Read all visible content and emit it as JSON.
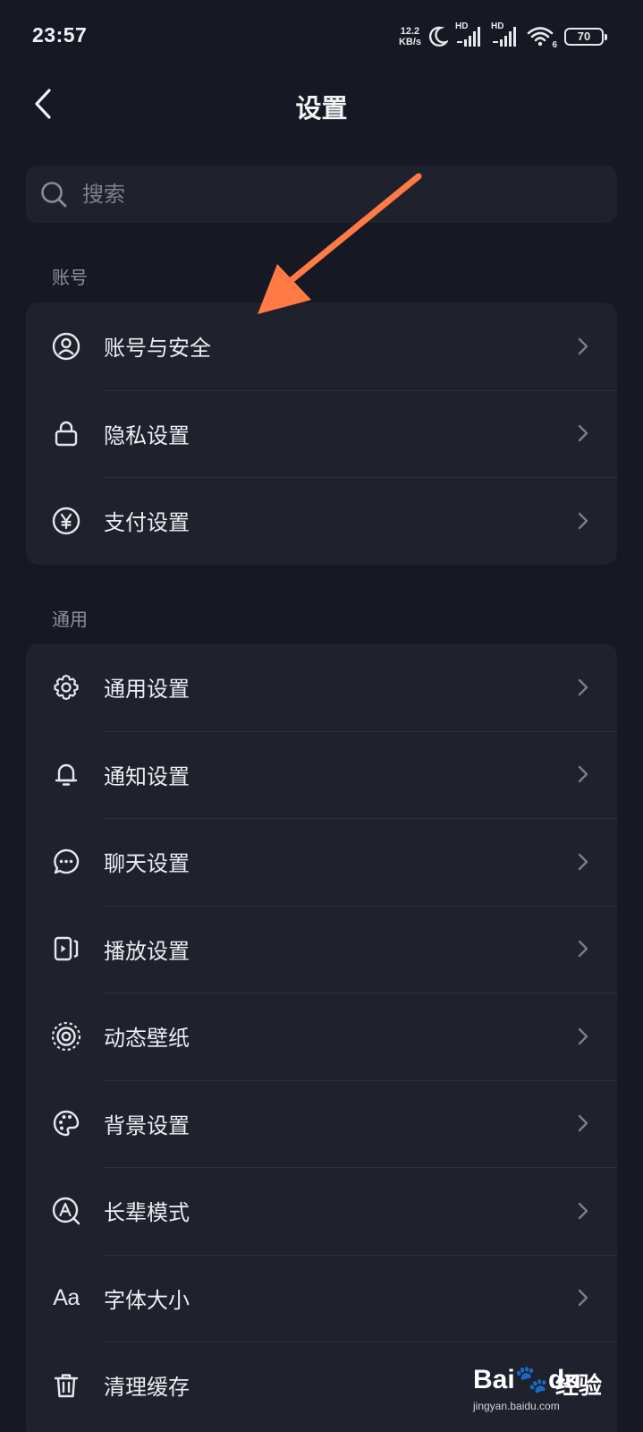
{
  "status_bar": {
    "time": "23:57",
    "net_speed_value": "12.2",
    "net_speed_unit": "KB/s",
    "signal_1_label": "HD",
    "signal_2_label": "HD",
    "wifi_badge": "6",
    "battery": "70"
  },
  "header": {
    "title": "设置"
  },
  "search": {
    "placeholder": "搜索"
  },
  "sections": [
    {
      "label": "账号",
      "items": [
        {
          "label": "账号与安全",
          "icon": "user-circle-icon"
        },
        {
          "label": "隐私设置",
          "icon": "lock-icon"
        },
        {
          "label": "支付设置",
          "icon": "yuan-icon"
        }
      ]
    },
    {
      "label": "通用",
      "items": [
        {
          "label": "通用设置",
          "icon": "gear-icon"
        },
        {
          "label": "通知设置",
          "icon": "bell-icon"
        },
        {
          "label": "聊天设置",
          "icon": "chat-bubble-icon"
        },
        {
          "label": "播放设置",
          "icon": "play-screen-icon"
        },
        {
          "label": "动态壁纸",
          "icon": "live-wallpaper-icon"
        },
        {
          "label": "背景设置",
          "icon": "palette-icon"
        },
        {
          "label": "长辈模式",
          "icon": "elder-mode-icon"
        },
        {
          "label": "字体大小",
          "icon": "font-size-icon",
          "glyph": "Aa"
        },
        {
          "label": "清理缓存",
          "icon": "trash-icon"
        }
      ]
    }
  ],
  "colors": {
    "background": "#161823",
    "card": "#1f212c",
    "annotation_arrow": "#ff7a45"
  },
  "watermark": {
    "logo_a": "Bai",
    "logo_b": "du",
    "text": "经验",
    "url": "jingyan.baidu.com"
  }
}
